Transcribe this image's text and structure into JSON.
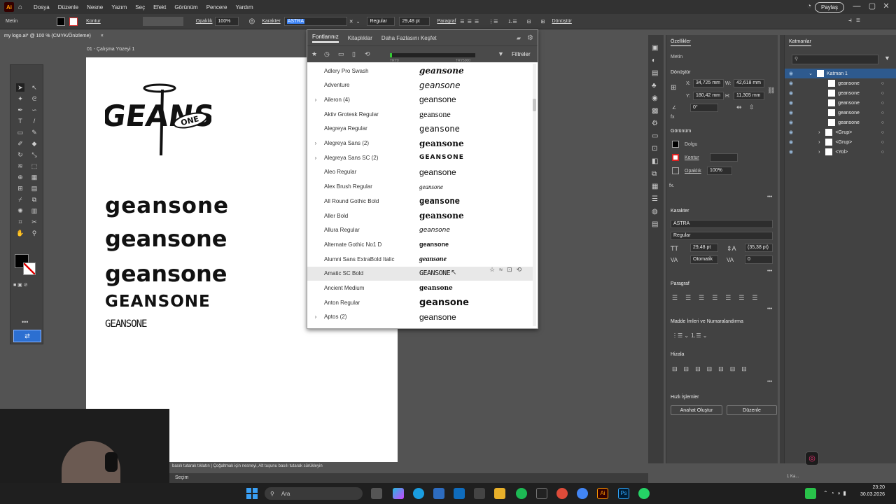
{
  "menubar": {
    "app_logo": "Ai",
    "items": [
      "Dosya",
      "Düzenle",
      "Nesne",
      "Yazım",
      "Seç",
      "Efekt",
      "Görünüm",
      "Pencere",
      "Yardım"
    ],
    "share_label": "Paylaş"
  },
  "control_bar": {
    "mode_label": "Metin",
    "stroke_label": "Kontur",
    "opacity_label": "Opaklık",
    "opacity_value": "100%",
    "character_label": "Karakter",
    "font_search_value": "ASTRA",
    "style_value": "Regular",
    "size_value": "29,48 pt",
    "paragraph_label": "Paragraf",
    "transform_label": "Dönüştür"
  },
  "document": {
    "tab_label": "my logo.ai* @ 100 % (CMYK/Önizleme)",
    "close_icon": "×",
    "artboard_label": "01 - Çalışma Yüzeyi 1"
  },
  "artboard": {
    "logo_text": "GEANS",
    "logo_sub": "ONE",
    "lines": [
      "geansone",
      "geansone",
      "geansone",
      "GEANSONE",
      "GEANSONE"
    ]
  },
  "font_panel": {
    "tabs": [
      "Fontlarınız",
      "Kitaplıklar",
      "Daha Fazlasını Keşfet"
    ],
    "filters_label": "Filtreler",
    "preview_label_left": "TRY0",
    "preview_label_right": "TRY5000",
    "fonts": [
      {
        "name": "Adlery Pro Swash",
        "preview": "geansone",
        "expand": false
      },
      {
        "name": "Adventure",
        "preview": "geansone",
        "expand": false
      },
      {
        "name": "Aileron (4)",
        "preview": "geansone",
        "expand": true
      },
      {
        "name": "Aktiv Grotesk Regular",
        "preview": "geansone",
        "expand": false
      },
      {
        "name": "Alegreya Regular",
        "preview": "geansone",
        "expand": false
      },
      {
        "name": "Alegreya Sans (2)",
        "preview": "geansone",
        "expand": true
      },
      {
        "name": "Alegreya Sans SC (2)",
        "preview": "GEANSONE",
        "expand": true
      },
      {
        "name": "Aleo Regular",
        "preview": "geansone",
        "expand": false
      },
      {
        "name": "Alex Brush Regular",
        "preview": "geansone",
        "expand": false
      },
      {
        "name": "All Round Gothic Bold",
        "preview": "geansone",
        "expand": false
      },
      {
        "name": "Aller Bold",
        "preview": "geansone",
        "expand": false
      },
      {
        "name": "Allura Regular",
        "preview": "geansone",
        "expand": false
      },
      {
        "name": "Alternate Gothic No1 D",
        "preview": "geansone",
        "expand": false
      },
      {
        "name": "Alumni Sans ExtraBold Italic",
        "preview": "geansone",
        "expand": false
      },
      {
        "name": "Amatic SC Bold",
        "preview": "GEANSONE",
        "expand": false
      },
      {
        "name": "Ancient Medium",
        "preview": "geansone",
        "expand": false
      },
      {
        "name": "Anton Regular",
        "preview": "geansone",
        "expand": false
      },
      {
        "name": "Aptos (2)",
        "preview": "geansone",
        "expand": true
      }
    ]
  },
  "properties": {
    "title": "Özellikler",
    "layers_tab": "Katmanlar",
    "type_label": "Metin",
    "transform_header": "Dönüştür",
    "x_label": "X:",
    "x_value": "34,725 mm",
    "y_label": "Y:",
    "y_value": "180,42 mm",
    "w_label": "W:",
    "w_value": "42,618 mm",
    "h_label": "H:",
    "h_value": "11,305 mm",
    "angle_value": "0°",
    "appearance_header": "Görünüm",
    "fill_label": "Dolgu",
    "stroke_label": "Kontur",
    "opacity_label": "Opaklık",
    "opacity_value": "100%",
    "character_header": "Karakter",
    "font_value": "ASTRA",
    "style_value": "Regular",
    "size_value": "29,48 pt",
    "leading_value": "(35,38 pt)",
    "kerning_value": "Otomatik",
    "tracking_value": "0",
    "paragraph_header": "Paragraf",
    "bullets_header": "Madde İmleri ve Numaralandırma",
    "align_header": "Hizala",
    "quick_header": "Hızlı İşlemler",
    "btn_outline": "Anahat Oluştur",
    "btn_arrange": "Düzenle"
  },
  "layers": {
    "layer_name": "Katman 1",
    "items": [
      "geansone",
      "geansone",
      "geansone",
      "geansone",
      "geansone",
      "<Grup>",
      "<Grup>",
      "<Yol>"
    ]
  },
  "status": {
    "hint": "basılı tutarak tıklatın | Çoğaltmak için nesneyi, Alt tuşunu basılı tutarak sürükleyin",
    "tool": "Seçim",
    "left_corner": "1 Ka..."
  },
  "taskbar": {
    "search_placeholder": "Ara",
    "time": "23:20",
    "date": "30.03.2026"
  }
}
